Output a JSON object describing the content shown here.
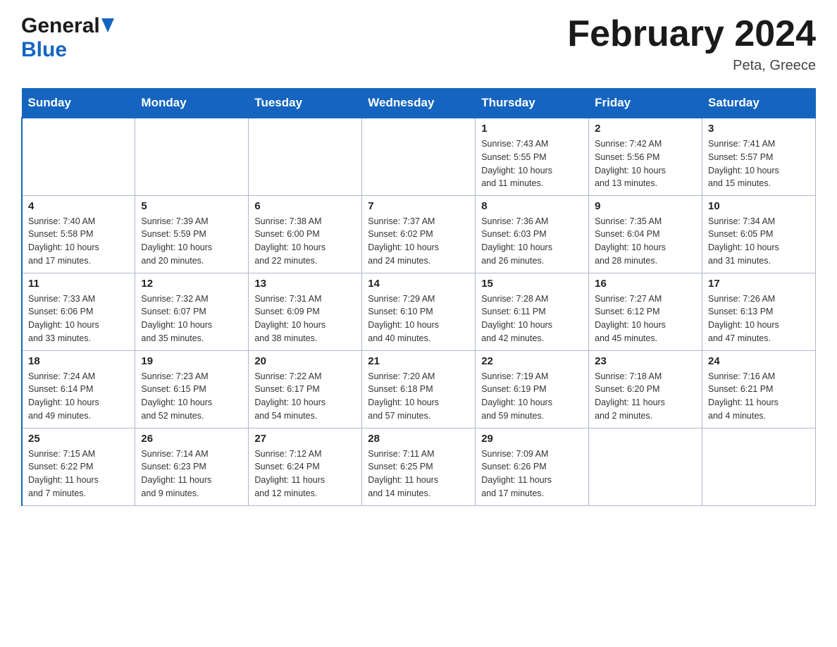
{
  "header": {
    "logo": {
      "general_text": "General",
      "blue_text": "Blue"
    },
    "title": "February 2024",
    "location": "Peta, Greece"
  },
  "calendar": {
    "days_of_week": [
      "Sunday",
      "Monday",
      "Tuesday",
      "Wednesday",
      "Thursday",
      "Friday",
      "Saturday"
    ],
    "weeks": [
      [
        {
          "day": "",
          "info": ""
        },
        {
          "day": "",
          "info": ""
        },
        {
          "day": "",
          "info": ""
        },
        {
          "day": "",
          "info": ""
        },
        {
          "day": "1",
          "info": "Sunrise: 7:43 AM\nSunset: 5:55 PM\nDaylight: 10 hours\nand 11 minutes."
        },
        {
          "day": "2",
          "info": "Sunrise: 7:42 AM\nSunset: 5:56 PM\nDaylight: 10 hours\nand 13 minutes."
        },
        {
          "day": "3",
          "info": "Sunrise: 7:41 AM\nSunset: 5:57 PM\nDaylight: 10 hours\nand 15 minutes."
        }
      ],
      [
        {
          "day": "4",
          "info": "Sunrise: 7:40 AM\nSunset: 5:58 PM\nDaylight: 10 hours\nand 17 minutes."
        },
        {
          "day": "5",
          "info": "Sunrise: 7:39 AM\nSunset: 5:59 PM\nDaylight: 10 hours\nand 20 minutes."
        },
        {
          "day": "6",
          "info": "Sunrise: 7:38 AM\nSunset: 6:00 PM\nDaylight: 10 hours\nand 22 minutes."
        },
        {
          "day": "7",
          "info": "Sunrise: 7:37 AM\nSunset: 6:02 PM\nDaylight: 10 hours\nand 24 minutes."
        },
        {
          "day": "8",
          "info": "Sunrise: 7:36 AM\nSunset: 6:03 PM\nDaylight: 10 hours\nand 26 minutes."
        },
        {
          "day": "9",
          "info": "Sunrise: 7:35 AM\nSunset: 6:04 PM\nDaylight: 10 hours\nand 28 minutes."
        },
        {
          "day": "10",
          "info": "Sunrise: 7:34 AM\nSunset: 6:05 PM\nDaylight: 10 hours\nand 31 minutes."
        }
      ],
      [
        {
          "day": "11",
          "info": "Sunrise: 7:33 AM\nSunset: 6:06 PM\nDaylight: 10 hours\nand 33 minutes."
        },
        {
          "day": "12",
          "info": "Sunrise: 7:32 AM\nSunset: 6:07 PM\nDaylight: 10 hours\nand 35 minutes."
        },
        {
          "day": "13",
          "info": "Sunrise: 7:31 AM\nSunset: 6:09 PM\nDaylight: 10 hours\nand 38 minutes."
        },
        {
          "day": "14",
          "info": "Sunrise: 7:29 AM\nSunset: 6:10 PM\nDaylight: 10 hours\nand 40 minutes."
        },
        {
          "day": "15",
          "info": "Sunrise: 7:28 AM\nSunset: 6:11 PM\nDaylight: 10 hours\nand 42 minutes."
        },
        {
          "day": "16",
          "info": "Sunrise: 7:27 AM\nSunset: 6:12 PM\nDaylight: 10 hours\nand 45 minutes."
        },
        {
          "day": "17",
          "info": "Sunrise: 7:26 AM\nSunset: 6:13 PM\nDaylight: 10 hours\nand 47 minutes."
        }
      ],
      [
        {
          "day": "18",
          "info": "Sunrise: 7:24 AM\nSunset: 6:14 PM\nDaylight: 10 hours\nand 49 minutes."
        },
        {
          "day": "19",
          "info": "Sunrise: 7:23 AM\nSunset: 6:15 PM\nDaylight: 10 hours\nand 52 minutes."
        },
        {
          "day": "20",
          "info": "Sunrise: 7:22 AM\nSunset: 6:17 PM\nDaylight: 10 hours\nand 54 minutes."
        },
        {
          "day": "21",
          "info": "Sunrise: 7:20 AM\nSunset: 6:18 PM\nDaylight: 10 hours\nand 57 minutes."
        },
        {
          "day": "22",
          "info": "Sunrise: 7:19 AM\nSunset: 6:19 PM\nDaylight: 10 hours\nand 59 minutes."
        },
        {
          "day": "23",
          "info": "Sunrise: 7:18 AM\nSunset: 6:20 PM\nDaylight: 11 hours\nand 2 minutes."
        },
        {
          "day": "24",
          "info": "Sunrise: 7:16 AM\nSunset: 6:21 PM\nDaylight: 11 hours\nand 4 minutes."
        }
      ],
      [
        {
          "day": "25",
          "info": "Sunrise: 7:15 AM\nSunset: 6:22 PM\nDaylight: 11 hours\nand 7 minutes."
        },
        {
          "day": "26",
          "info": "Sunrise: 7:14 AM\nSunset: 6:23 PM\nDaylight: 11 hours\nand 9 minutes."
        },
        {
          "day": "27",
          "info": "Sunrise: 7:12 AM\nSunset: 6:24 PM\nDaylight: 11 hours\nand 12 minutes."
        },
        {
          "day": "28",
          "info": "Sunrise: 7:11 AM\nSunset: 6:25 PM\nDaylight: 11 hours\nand 14 minutes."
        },
        {
          "day": "29",
          "info": "Sunrise: 7:09 AM\nSunset: 6:26 PM\nDaylight: 11 hours\nand 17 minutes."
        },
        {
          "day": "",
          "info": ""
        },
        {
          "day": "",
          "info": ""
        }
      ]
    ]
  }
}
